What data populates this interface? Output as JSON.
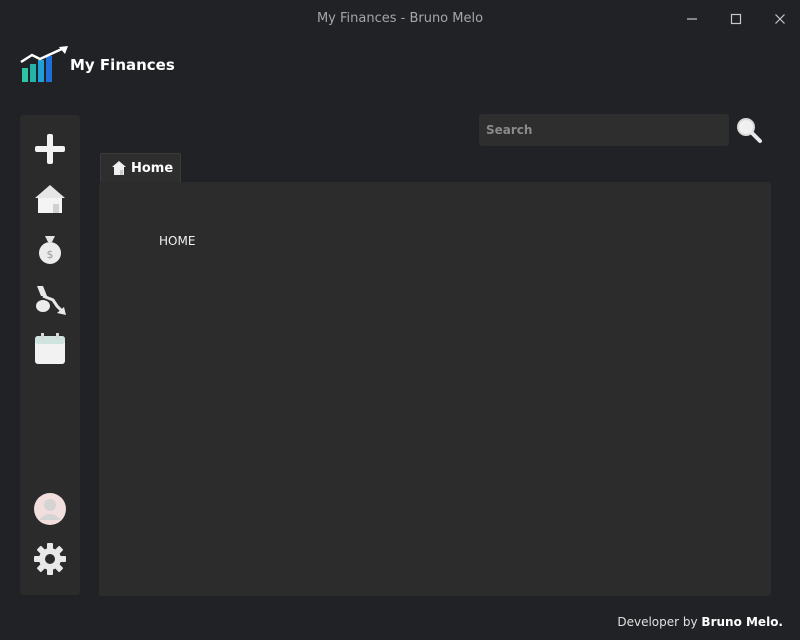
{
  "window": {
    "title": "My Finances - Bruno Melo",
    "controls": [
      "minimize-icon",
      "maximize-icon",
      "close-icon"
    ]
  },
  "header": {
    "app_name": "My Finances",
    "logo_icon": "growth-chart-icon"
  },
  "sidebar": {
    "items": [
      {
        "icon": "plus-icon",
        "label": "add"
      },
      {
        "icon": "home-icon",
        "label": "home"
      },
      {
        "icon": "money-bag-icon",
        "label": "income"
      },
      {
        "icon": "expense-icon",
        "label": "expenses"
      },
      {
        "icon": "calendar-icon",
        "label": "calendar"
      }
    ],
    "bottom_items": [
      {
        "icon": "user-avatar-icon",
        "label": "profile"
      },
      {
        "icon": "gear-icon",
        "label": "settings"
      }
    ]
  },
  "search": {
    "placeholder": "Search",
    "value": ""
  },
  "tabs": [
    {
      "label": "Home",
      "icon": "home-icon",
      "active": true
    }
  ],
  "content": {
    "page_label": "HOME"
  },
  "footer": {
    "prefix": "Developer by",
    "author": "Bruno Melo."
  },
  "colors": {
    "background": "#202226",
    "panel": "#2b2b2b",
    "content": "#2c2c2c",
    "logo_teal": "#2ec4a6",
    "logo_blue": "#1e88e5"
  }
}
